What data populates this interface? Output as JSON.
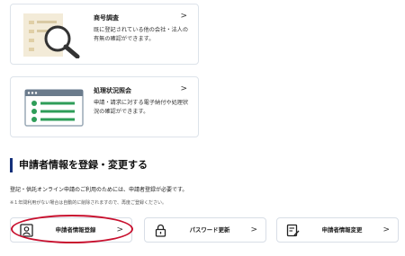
{
  "cards": [
    {
      "title": "商号調査",
      "arrow": ">",
      "description": "既に登記されている他の会社・法人の有無の確認ができます。",
      "illustration_icon": "magnifier-document-icon"
    },
    {
      "title": "処理状況照会",
      "arrow": ">",
      "description": "申請・請求に対する電子納付や処理状況の確認ができます。",
      "illustration_icon": "checklist-window-icon"
    }
  ],
  "section": {
    "title": "申請者情報を登録・変更する",
    "description": "登記・供託オンライン申請のご利用のためには、申請者登録が必要です。",
    "note": "※１年間利用がない場合は自動的に削除されますので、再度ご登録ください。"
  },
  "buttons": [
    {
      "label": "申請者情報登録",
      "arrow": ">",
      "icon": "user-id-card-icon"
    },
    {
      "label": "パスワード更新",
      "arrow": ">",
      "icon": "lock-icon"
    },
    {
      "label": "申請者情報変更",
      "arrow": ">",
      "icon": "edit-document-icon"
    }
  ],
  "colors": {
    "accent": "#14307a",
    "highlight": "#c8102e",
    "illustration_green": "#2e9d58",
    "illustration_beige": "#f3ebd8"
  }
}
